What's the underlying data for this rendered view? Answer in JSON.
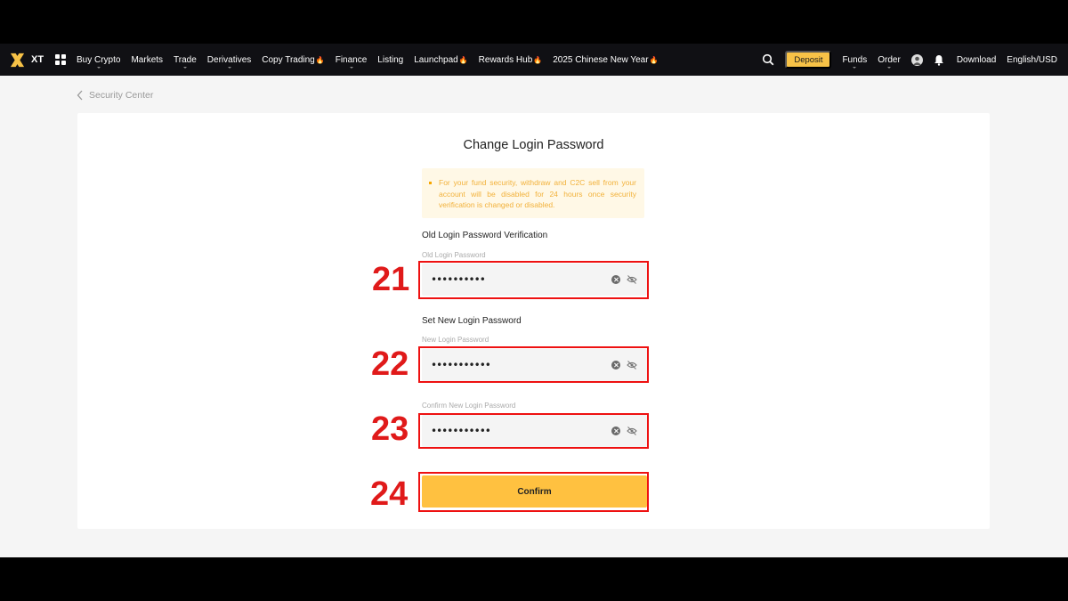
{
  "nav": {
    "logo_text": "XT",
    "items": [
      {
        "label": "Buy Crypto",
        "caret": true,
        "flame": false
      },
      {
        "label": "Markets",
        "caret": false,
        "flame": false
      },
      {
        "label": "Trade",
        "caret": true,
        "flame": false
      },
      {
        "label": "Derivatives",
        "caret": true,
        "flame": false
      },
      {
        "label": "Copy Trading",
        "caret": false,
        "flame": true
      },
      {
        "label": "Finance",
        "caret": true,
        "flame": false
      },
      {
        "label": "Listing",
        "caret": false,
        "flame": false
      },
      {
        "label": "Launchpad",
        "caret": false,
        "flame": true
      },
      {
        "label": "Rewards Hub",
        "caret": false,
        "flame": true
      },
      {
        "label": "2025 Chinese New Year",
        "caret": false,
        "flame": true
      }
    ],
    "deposit_label": "Deposit",
    "funds_label": "Funds",
    "order_label": "Order",
    "download_label": "Download",
    "language_label": "English/USD",
    "flame_glyph": "🔥",
    "accent_color": "#f7c247"
  },
  "breadcrumb": {
    "label": "Security Center"
  },
  "page": {
    "title": "Change Login Password",
    "notice": "For your fund security, withdraw and C2C sell from your account will be disabled for 24 hours once security verification is changed or disabled.",
    "old_section": "Old Login Password Verification",
    "old_field_label": "Old Login Password",
    "old_field_value": "••••••••••",
    "new_section": "Set New Login Password",
    "new_field_label": "New Login Password",
    "new_field_value": "•••••••••••",
    "confirm_field_label": "Confirm New Login Password",
    "confirm_field_value": "•••••••••••",
    "confirm_button": "Confirm"
  },
  "annotations": {
    "n21": "21",
    "n22": "22",
    "n23": "23",
    "n24": "24",
    "color": "#e11111"
  }
}
